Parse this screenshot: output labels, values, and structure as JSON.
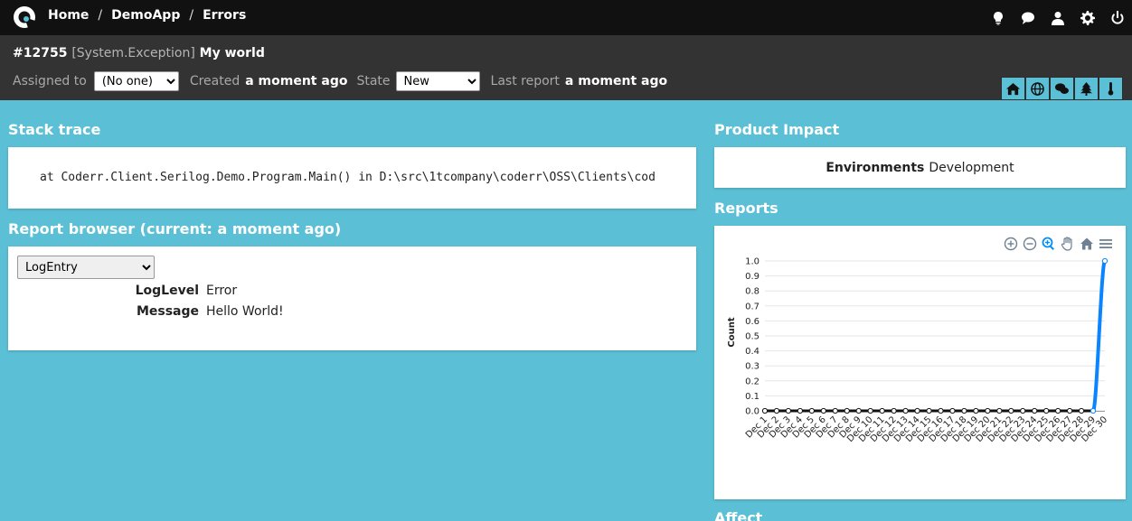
{
  "nav": {
    "crumbs": [
      "Home",
      "DemoApp",
      "Errors"
    ],
    "separator": "/",
    "icons": [
      "lightbulb-icon",
      "chat-icon",
      "user-icon",
      "gear-icon",
      "power-icon"
    ]
  },
  "incident": {
    "id": "#12755",
    "exception": "[System.Exception]",
    "name": "My world",
    "assigned_label": "Assigned to",
    "assigned_value": "(No one)",
    "created_label": "Created",
    "created_value": "a moment ago",
    "state_label": "State",
    "state_value": "New",
    "last_report_label": "Last report",
    "last_report_value": "a moment ago"
  },
  "tabs": [
    "home-icon",
    "globe-icon",
    "comments-icon",
    "tree-icon",
    "thermometer-icon"
  ],
  "stack_trace": {
    "title": "Stack trace",
    "text": "at Coderr.Client.Serilog.Demo.Program.Main() in D:\\src\\1tcompany\\coderr\\OSS\\Clients\\cod"
  },
  "report_browser": {
    "title": "Report browser (current: a moment ago)",
    "selected": "LogEntry",
    "fields": [
      {
        "key": "LogLevel",
        "value": "Error"
      },
      {
        "key": "Message",
        "value": "Hello World!"
      }
    ]
  },
  "product_impact": {
    "title": "Product Impact",
    "key": "Environments",
    "value": "Development"
  },
  "reports": {
    "title": "Reports"
  },
  "affect": {
    "title": "Affect"
  },
  "colors": {
    "accent": "#5bc0d6",
    "topbar": "#111111",
    "header": "#333333",
    "series": "#0a84ff",
    "grid": "#e6e6e6"
  },
  "chart_data": {
    "type": "line",
    "title": "",
    "xlabel": "",
    "ylabel": "Count",
    "ylim": [
      0,
      1
    ],
    "yticks": [
      0.0,
      0.1,
      0.2,
      0.3,
      0.4,
      0.5,
      0.6,
      0.7,
      0.8,
      0.9,
      1.0
    ],
    "categories": [
      "Dec 1",
      "Dec 2",
      "Dec 3",
      "Dec 4",
      "Dec 5",
      "Dec 6",
      "Dec 7",
      "Dec 8",
      "Dec 9",
      "Dec 10",
      "Dec 11",
      "Dec 12",
      "Dec 13",
      "Dec 14",
      "Dec 15",
      "Dec 16",
      "Dec 17",
      "Dec 18",
      "Dec 19",
      "Dec 20",
      "Dec 21",
      "Dec 22",
      "Dec 23",
      "Dec 24",
      "Dec 25",
      "Dec 26",
      "Dec 27",
      "Dec 28",
      "Dec 29",
      "Dec 30"
    ],
    "series": [
      {
        "values": [
          0,
          0,
          0,
          0,
          0,
          0,
          0,
          0,
          0,
          0,
          0,
          0,
          0,
          0,
          0,
          0,
          0,
          0,
          0,
          0,
          0,
          0,
          0,
          0,
          0,
          0,
          0,
          0,
          0,
          1
        ]
      }
    ],
    "grid": true,
    "legend": "none"
  }
}
